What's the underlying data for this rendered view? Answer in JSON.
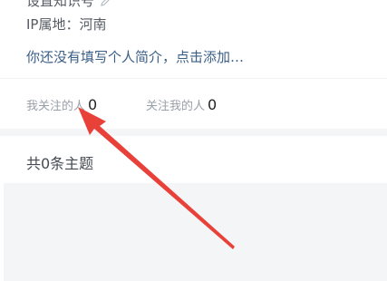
{
  "profile": {
    "cut_line_text": "设置知识号",
    "edit_icon": "edit-pencil-icon",
    "ip_location": "IP属地：河南",
    "bio_prompt": "你还没有填写个人简介，点击添加…"
  },
  "follow": {
    "following_label": "我关注的人",
    "following_count": "0",
    "followers_label": "关注我的人",
    "followers_count": "0"
  },
  "topics": {
    "count_text": "共0条主题"
  },
  "annotation": {
    "arrow_color": "#e8413a",
    "target": "follow-following-item"
  }
}
